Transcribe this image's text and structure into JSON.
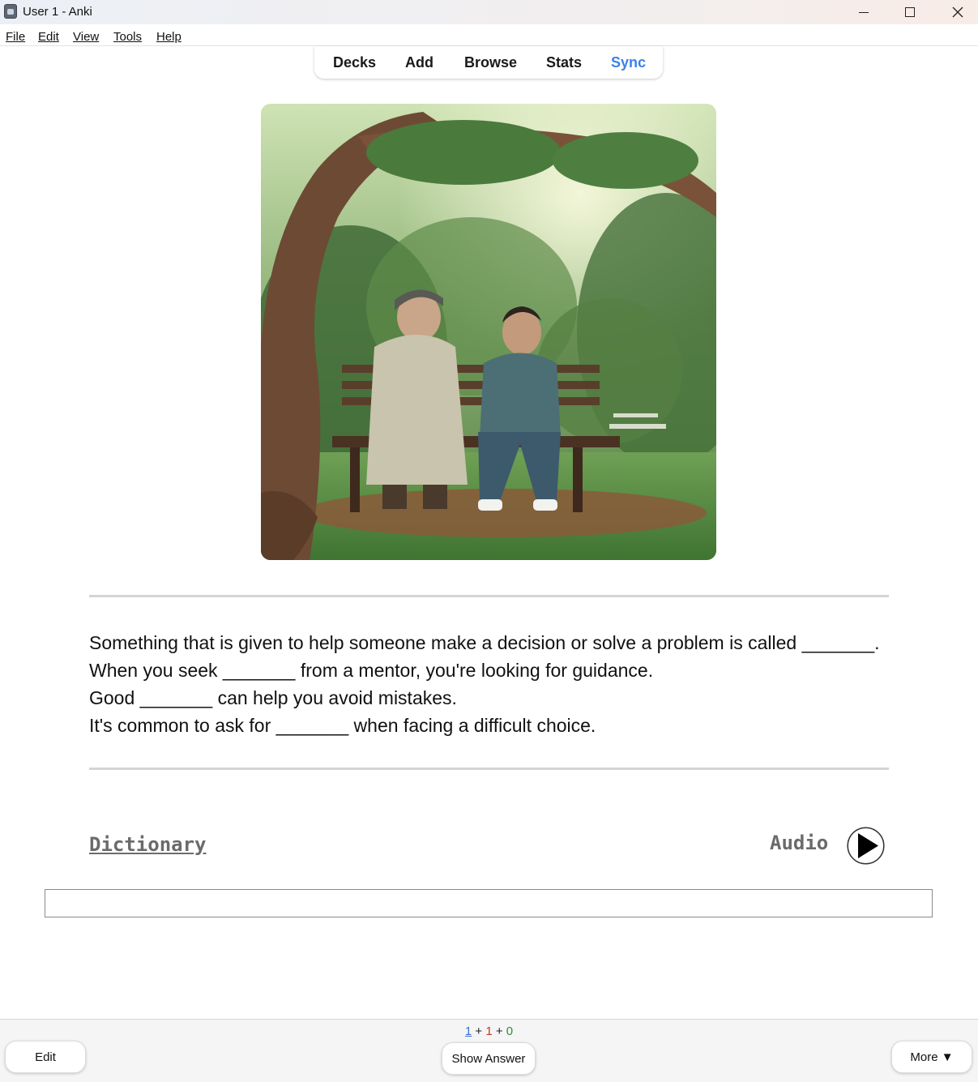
{
  "window": {
    "title": "User 1 - Anki",
    "controls": [
      "minimize-icon",
      "maximize-icon",
      "close-icon"
    ]
  },
  "menu": [
    "File",
    "Edit",
    "View",
    "Tools",
    "Help"
  ],
  "toolbar": {
    "decks": "Decks",
    "add": "Add",
    "browse": "Browse",
    "stats": "Stats",
    "sync": "Sync"
  },
  "card": {
    "image_icon": "park-bench-illustration",
    "sentences": [
      "Something that is given to help someone make a decision or solve a problem is called _______.",
      "When you seek _______ from a mentor, you're looking for guidance.",
      "Good _______ can help you avoid mistakes.",
      "It's common to ask for _______ when facing a difficult choice."
    ],
    "dictionary_link": "Dictionary",
    "audio_label": "Audio",
    "answer_value": ""
  },
  "bottom": {
    "count_new": "1",
    "count_learn": "1",
    "count_review": "0",
    "count_sep": "+",
    "edit": "Edit",
    "show_answer": "Show Answer",
    "more": "More ▼"
  },
  "colors": {
    "sync_link": "#3b82e8",
    "count_new": "#3b6fd8",
    "count_learn": "#c8342a",
    "count_review": "#2a8f3b"
  }
}
